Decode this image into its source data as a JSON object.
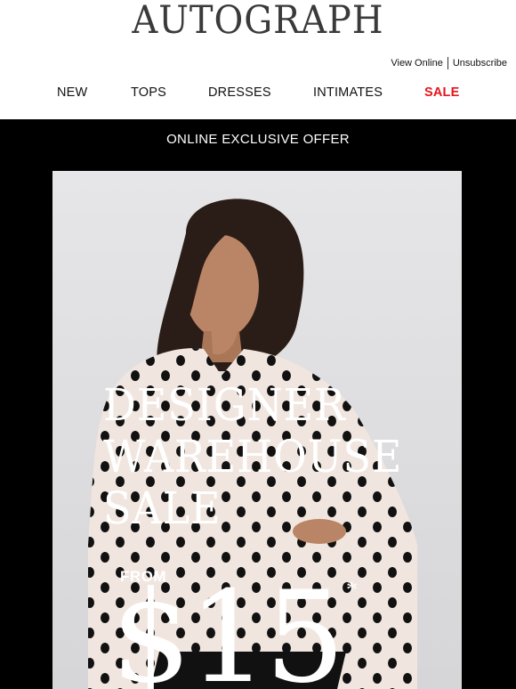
{
  "brand": {
    "logo": "AUTOGRAPH"
  },
  "utility_links": {
    "view_online": "View Online",
    "unsubscribe": "Unsubscribe"
  },
  "nav": [
    {
      "label": "NEW"
    },
    {
      "label": "TOPS"
    },
    {
      "label": "DRESSES"
    },
    {
      "label": "INTIMATES"
    },
    {
      "label": "SALE",
      "color": "#e8141b"
    }
  ],
  "offer_banner": "ONLINE EXCLUSIVE OFFER",
  "hero": {
    "headline_lines": [
      "DESIGNER",
      "WAREHOUSE",
      "SALE"
    ],
    "from_label": "FROM",
    "price": "$15",
    "asterisk": "*"
  },
  "colors": {
    "sale_red": "#e8141b",
    "banner_bg": "#000000",
    "text_on_dark": "#ffffff"
  }
}
